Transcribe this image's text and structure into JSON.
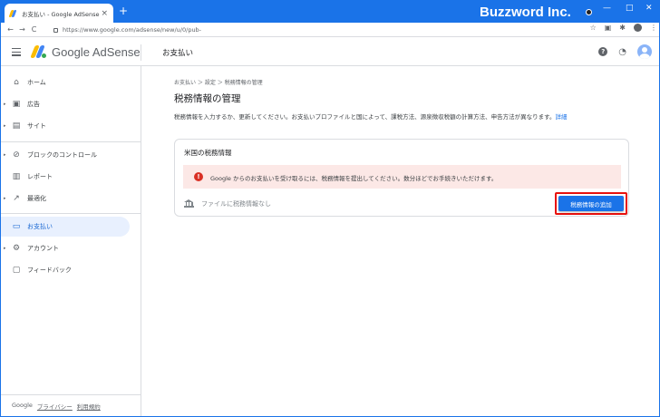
{
  "browser": {
    "tab_title": "お支払い - Google AdSense",
    "tab_close": "×",
    "new_tab": "+",
    "url": "https://www.google.com/adsense/new/u/0/pub-",
    "back": "←",
    "forward": "→",
    "reload": "C",
    "star": "☆",
    "menu": "⋮",
    "minimize": "—",
    "maximize": "□",
    "close": "✕"
  },
  "watermark": "Buzzword Inc.",
  "header": {
    "app_name": "Google AdSense",
    "page_title": "お支払い",
    "help": "?",
    "bell": "🔔"
  },
  "sidebar": {
    "items": [
      {
        "label": "ホーム",
        "icon": "home-icon",
        "glyph": "⌂",
        "arrow": ""
      },
      {
        "label": "広告",
        "icon": "ads-icon",
        "glyph": "▣",
        "arrow": "▸"
      },
      {
        "label": "サイト",
        "icon": "sites-icon",
        "glyph": "▤",
        "arrow": "▸"
      },
      {
        "label": "ブロックのコントロール",
        "icon": "block-icon",
        "glyph": "⊘",
        "arrow": "▸"
      },
      {
        "label": "レポート",
        "icon": "report-icon",
        "glyph": "▥",
        "arrow": ""
      },
      {
        "label": "最適化",
        "icon": "optimize-icon",
        "glyph": "↗",
        "arrow": "▸"
      },
      {
        "label": "お支払い",
        "icon": "payments-icon",
        "glyph": "▭",
        "arrow": ""
      },
      {
        "label": "アカウント",
        "icon": "account-icon",
        "glyph": "⚙",
        "arrow": "▸"
      },
      {
        "label": "フィードバック",
        "icon": "feedback-icon",
        "glyph": "▢",
        "arrow": ""
      }
    ],
    "active": "お支払い",
    "footer": {
      "google": "Google",
      "privacy": "プライバシー",
      "terms": "利用規約"
    }
  },
  "main": {
    "breadcrumb": "お支払い ＞ 設定 ＞ 税務情報の管理",
    "title": "税務情報の管理",
    "description": "税務情報を入力するか、更新してください。お支払いプロファイルと国によって、課税方法、源泉徴収税額の計算方法、申告方法が異なります。",
    "description_link": "詳細",
    "card": {
      "title": "米国の税務情報",
      "alert_icon": "!",
      "alert": "Google からのお支払いを受け取るには、税務情報を提出してください。数分ほどでお手続きいただけます。",
      "no_file": "ファイルに税務情報なし",
      "add_button": "税務情報の追加"
    }
  },
  "colors": {
    "accent": "#1a73e8",
    "alert_bg": "#fce8e6",
    "error": "#d93025",
    "highlight": "#e8110d"
  }
}
